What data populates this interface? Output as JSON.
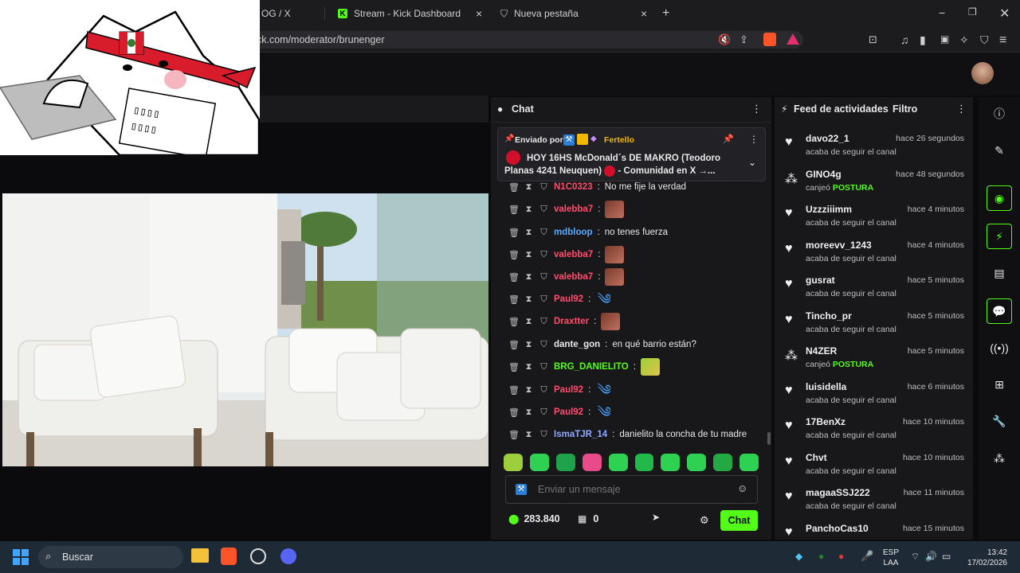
{
  "browser": {
    "tabs": [
      {
        "label": "OG / X"
      },
      {
        "label": "Stream - Kick Dashboard"
      },
      {
        "label": "Nueva pestaña"
      }
    ],
    "url": "ck.com/moderator/brunenger"
  },
  "chat": {
    "title": "Chat",
    "pinned": {
      "sent_by_label": "Enviado por",
      "sender": "Fertello",
      "text": "HOY 16HS McDonald´s DE MAKRO (Teodoro Planas 4241 Neuquen)",
      "text_tail": "- Comunidad en X →..."
    },
    "messages": [
      {
        "user": "N1C0323",
        "color": "#ff4d6d",
        "text": "No me fije la verdad"
      },
      {
        "user": "valebba7",
        "color": "#ff4d6d",
        "text": ""
      },
      {
        "user": "mdbloop",
        "color": "#5aa9ff",
        "text": "no tenes fuerza"
      },
      {
        "user": "valebba7",
        "color": "#ff4d6d",
        "text": ""
      },
      {
        "user": "valebba7",
        "color": "#ff4d6d",
        "text": ""
      },
      {
        "user": "Paul92",
        "color": "#ff4d6d",
        "text": ""
      },
      {
        "user": "Draxtter",
        "color": "#ff4d6d",
        "text": ""
      },
      {
        "user": "dante_gon",
        "color": "#e8e8e8",
        "text": "en qué barrio están?"
      },
      {
        "user": "BRG_DANIELITO",
        "color": "#53fc18",
        "text": ""
      },
      {
        "user": "Paul92",
        "color": "#ff4d6d",
        "text": ""
      },
      {
        "user": "Paul92",
        "color": "#ff4d6d",
        "text": ""
      },
      {
        "user": "IsmaTJR_14",
        "color": "#8fa8ff",
        "text": "danielito la concha de tu madre"
      }
    ],
    "input_placeholder": "Enviar un mensaje",
    "points": "283.840",
    "store_count": "0",
    "send_label": "Chat"
  },
  "feed": {
    "title": "Feed de actividades",
    "filter_label": "Filtro",
    "items": [
      {
        "user": "davo22_1",
        "time": "hace 26 segundos",
        "action": "acaba de seguir el canal",
        "reward": "",
        "kind": "heart"
      },
      {
        "user": "GINO4g",
        "time": "hace 48 segundos",
        "action": "canjeó",
        "reward": "POSTURA",
        "kind": "points"
      },
      {
        "user": "Uzzziiimm",
        "time": "hace 4 minutos",
        "action": "acaba de seguir el canal",
        "reward": "",
        "kind": "heart"
      },
      {
        "user": "moreevv_1243",
        "time": "hace 4 minutos",
        "action": "acaba de seguir el canal",
        "reward": "",
        "kind": "heart"
      },
      {
        "user": "gusrat",
        "time": "hace 5 minutos",
        "action": "acaba de seguir el canal",
        "reward": "",
        "kind": "heart"
      },
      {
        "user": "Tincho_pr",
        "time": "hace 5 minutos",
        "action": "acaba de seguir el canal",
        "reward": "",
        "kind": "heart"
      },
      {
        "user": "N4ZER",
        "time": "hace 5 minutos",
        "action": "canjeó",
        "reward": "POSTURA",
        "kind": "points"
      },
      {
        "user": "luisidella",
        "time": "hace 6 minutos",
        "action": "acaba de seguir el canal",
        "reward": "",
        "kind": "heart"
      },
      {
        "user": "17BenXz",
        "time": "hace 10 minutos",
        "action": "acaba de seguir el canal",
        "reward": "",
        "kind": "heart"
      },
      {
        "user": "Chvt",
        "time": "hace 10 minutos",
        "action": "acaba de seguir el canal",
        "reward": "",
        "kind": "heart"
      },
      {
        "user": "magaaSSJ222",
        "time": "hace 11 minutos",
        "action": "acaba de seguir el canal",
        "reward": "",
        "kind": "heart"
      },
      {
        "user": "PanchoCas10",
        "time": "hace 15 minutos",
        "action": "",
        "reward": "",
        "kind": "heart"
      }
    ]
  },
  "taskbar": {
    "search_placeholder": "Buscar",
    "lang": "ESP",
    "region": "LAA",
    "time": "13:42",
    "date": "17/02/2026"
  },
  "colors": {
    "accent": "#53fc18",
    "bg": "#18181b"
  }
}
